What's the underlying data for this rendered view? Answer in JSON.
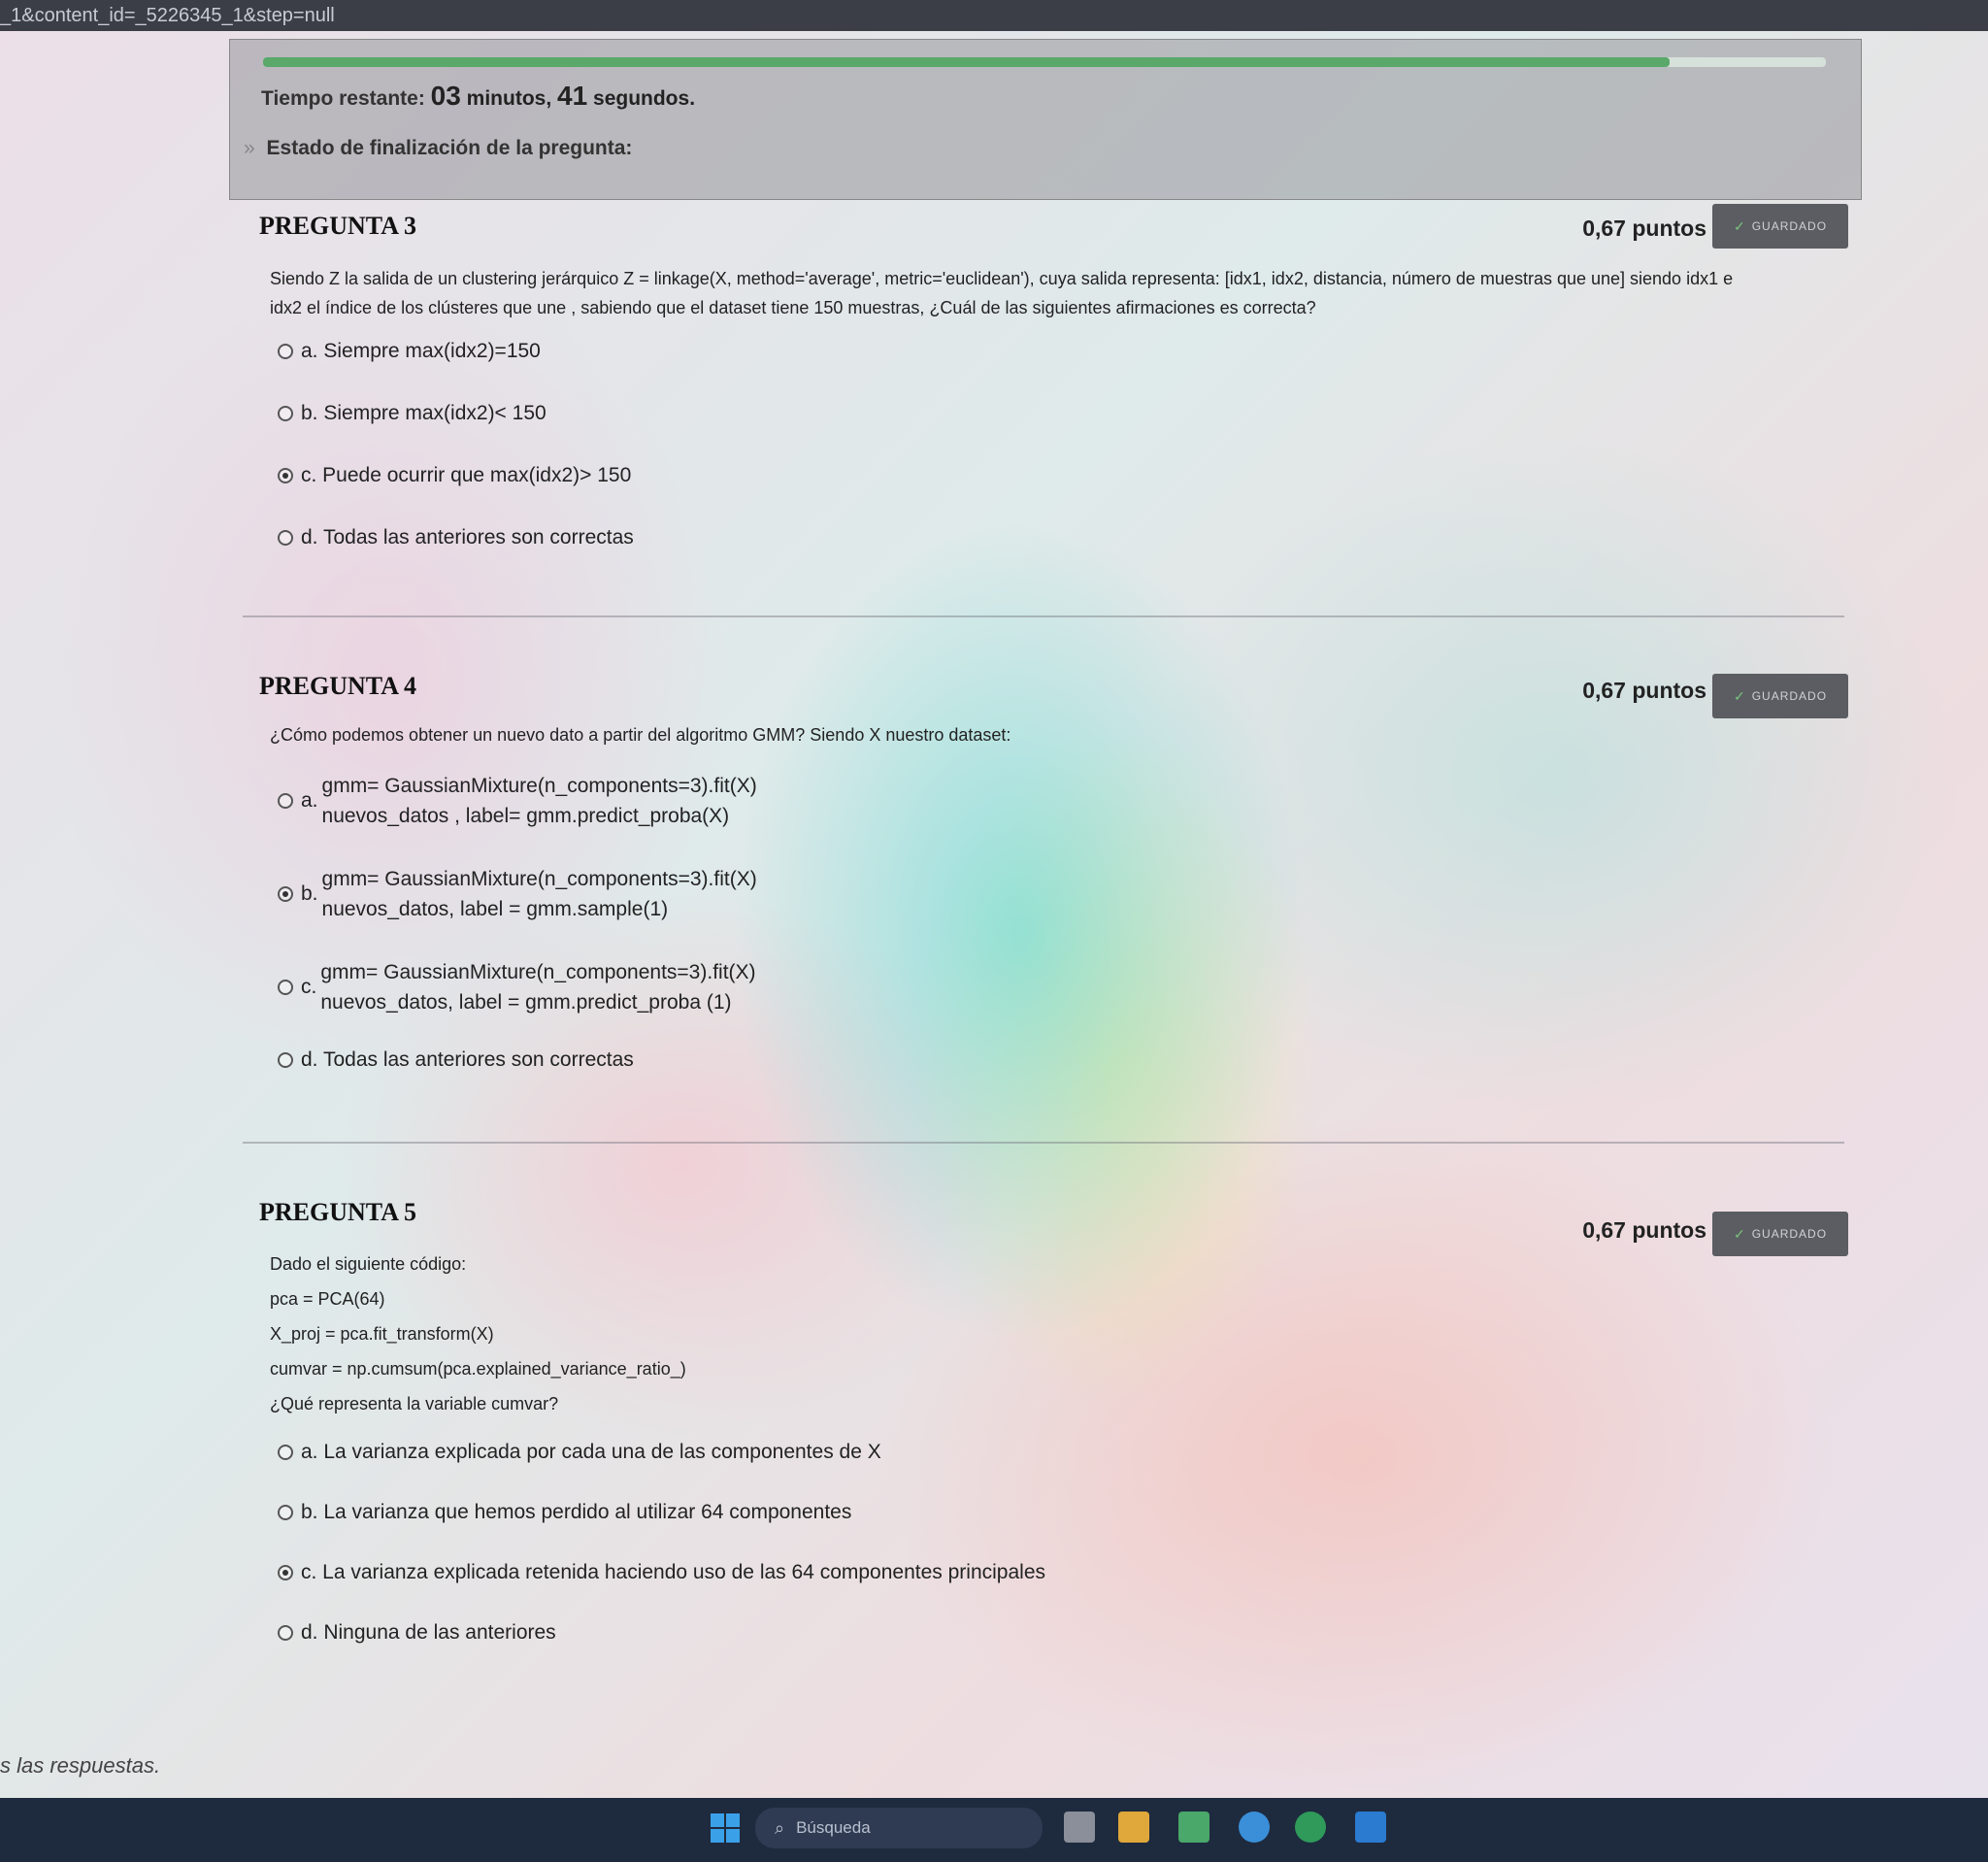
{
  "browser": {
    "url_fragment": "_1&content_id=_5226345_1&step=null"
  },
  "timer": {
    "label": "Tiempo restante:",
    "minutes": "03",
    "minutes_word": "minutos,",
    "seconds": "41",
    "seconds_word": "segundos.",
    "progress_fraction": 0.9,
    "status_label": "Estado de finalización de la pregunta:"
  },
  "questions": [
    {
      "title": "PREGUNTA 3",
      "points": "0,67 puntos",
      "badge": "GUARDADO",
      "text_line1": "Siendo Z la salida de un clustering jerárquico Z = linkage(X, method='average', metric='euclidean'), cuya salida representa: [idx1, idx2, distancia, número de muestras que une] siendo idx1 e",
      "text_line2": "idx2 el índice de los clústeres que une , sabiendo que el dataset tiene 150 muestras, ¿Cuál de las siguientes afirmaciones es correcta?",
      "options": [
        {
          "label": "a. Siempre max(idx2)=150",
          "selected": false
        },
        {
          "label": "b. Siempre max(idx2)< 150",
          "selected": false
        },
        {
          "label": "c. Puede ocurrir que max(idx2)> 150",
          "selected": true
        },
        {
          "label": "d. Todas las anteriores son correctas",
          "selected": false
        }
      ]
    },
    {
      "title": "PREGUNTA 4",
      "points": "0,67 puntos",
      "badge": "GUARDADO",
      "text_line1": "¿Cómo podemos obtener un nuevo dato a partir del algoritmo GMM? Siendo X nuestro dataset:",
      "options": [
        {
          "letter": "a.",
          "line1": "gmm= GaussianMixture(n_components=3).fit(X)",
          "line2": "nuevos_datos , label= gmm.predict_proba(X)",
          "selected": false
        },
        {
          "letter": "b.",
          "line1": "gmm= GaussianMixture(n_components=3).fit(X)",
          "line2": "nuevos_datos, label = gmm.sample(1)",
          "selected": true
        },
        {
          "letter": "c.",
          "line1": "gmm= GaussianMixture(n_components=3).fit(X)",
          "line2": "nuevos_datos, label = gmm.predict_proba (1)",
          "selected": false
        },
        {
          "label": "d. Todas las anteriores son correctas",
          "selected": false
        }
      ]
    },
    {
      "title": "PREGUNTA 5",
      "points": "0,67 puntos",
      "badge": "GUARDADO",
      "intro": "Dado el siguiente código:",
      "code": [
        "pca = PCA(64)",
        "X_proj = pca.fit_transform(X)",
        "cumvar = np.cumsum(pca.explained_variance_ratio_)"
      ],
      "prompt": "¿Qué representa la variable cumvar?",
      "options": [
        {
          "label": "a. La varianza explicada por cada una de las componentes de X",
          "selected": false
        },
        {
          "label": "b. La varianza que hemos perdido al utilizar 64 componentes",
          "selected": false
        },
        {
          "label": "c. La varianza explicada retenida haciendo uso de las 64 componentes principales",
          "selected": true
        },
        {
          "label": "d. Ninguna de las anteriores",
          "selected": false
        }
      ]
    }
  ],
  "footer_note": "s las respuestas.",
  "taskbar": {
    "search_placeholder": "Búsqueda"
  },
  "colors": {
    "badge_bg": "#5b5d62",
    "progress": "#5aa86a",
    "taskbar": "#1e2a3e"
  }
}
